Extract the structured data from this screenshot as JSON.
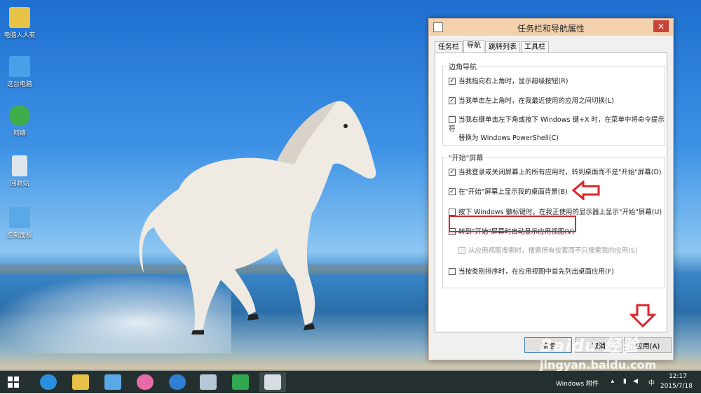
{
  "desktop_icons": [
    {
      "label": "电脑人人有",
      "icon": "user-folder-icon",
      "color": "#e8c247"
    },
    {
      "label": "这台电脑",
      "icon": "computer-icon",
      "color": "#4aa0e8"
    },
    {
      "label": "网络",
      "icon": "network-globe-icon",
      "color": "#3fae4a"
    },
    {
      "label": "回收站",
      "icon": "recycle-bin-icon",
      "color": "#dfe7ee"
    },
    {
      "label": "控制面板",
      "icon": "control-panel-icon",
      "color": "#5aa9e6"
    }
  ],
  "dialog": {
    "title": "任务栏和导航属性",
    "close_label": "✕",
    "tabs": [
      {
        "label": "任务栏",
        "active": false
      },
      {
        "label": "导航",
        "active": true
      },
      {
        "label": "跳转列表",
        "active": false
      },
      {
        "label": "工具栏",
        "active": false
      }
    ],
    "corner_nav": {
      "title": "边角导航",
      "options": [
        {
          "label": "当我指向右上角时，显示超级按钮(R)",
          "checked": true
        },
        {
          "label": "当我单击左上角时，在我最近使用的应用之间切换(L)",
          "checked": true
        },
        {
          "label": "当我右键单击左下角或按下 Windows 键+X 时，在菜单中将命令提示符",
          "label2": "替换为 Windows PowerShell(C)",
          "checked": false
        }
      ]
    },
    "start_screen": {
      "title": "\"开始\"屏幕",
      "options": [
        {
          "label": "当我登录或关闭屏幕上的所有应用时，转到桌面而不是\"开始\"屏幕(D)",
          "checked": true
        },
        {
          "label": "在\"开始\"屏幕上显示我的桌面背景(B)",
          "checked": true
        },
        {
          "label": "按下 Windows 徽标键时，在我正使用的显示器上显示\"开始\"屏幕(U)",
          "checked": false
        },
        {
          "label": "转到\"开始\"屏幕时自动显示应用视图(V)",
          "checked": false
        },
        {
          "label": "从应用视图搜索时，搜索所有位置而不只搜索我的应用(S)",
          "checked": false,
          "disabled": true
        },
        {
          "label": "当按类别排序时，在应用视图中首先列出桌面应用(F)",
          "checked": false
        }
      ]
    },
    "buttons": {
      "ok": "确定",
      "cancel": "取消",
      "apply": "应用(A)"
    }
  },
  "taskbar": {
    "apps": [
      {
        "name": "start-button",
        "icon": "windows-logo-icon",
        "color": "#ffffff"
      },
      {
        "name": "taskbar-ie",
        "icon": "internet-explorer-icon",
        "color": "#2a8fe0"
      },
      {
        "name": "taskbar-explorer",
        "icon": "file-explorer-icon",
        "color": "#e8c247"
      },
      {
        "name": "taskbar-remote",
        "icon": "remote-desktop-icon",
        "color": "#5aa9e6"
      },
      {
        "name": "taskbar-app-pink",
        "icon": "smiley-app-icon",
        "color": "#e86aa8"
      },
      {
        "name": "taskbar-sogou",
        "icon": "sogou-s-icon",
        "color": "#2f7fd6"
      },
      {
        "name": "taskbar-paint",
        "icon": "paint-palette-icon",
        "color": "#b7c7d6"
      },
      {
        "name": "taskbar-store",
        "icon": "store-bag-icon",
        "color": "#2fa84f"
      },
      {
        "name": "taskbar-properties",
        "icon": "properties-window-icon",
        "color": "#d7dde3"
      }
    ],
    "tray_label": "Windows 附件",
    "ime": "中",
    "time": "12:17",
    "date": "2015/7/18"
  },
  "watermark": {
    "brand": "Baidu 经验",
    "url": "jingyan.baidu.com"
  },
  "colors": {
    "highlight_border": "#d8262c",
    "titlebar": "#f3d1ad",
    "close_button": "#c7443a",
    "taskbar": "#24302f"
  }
}
